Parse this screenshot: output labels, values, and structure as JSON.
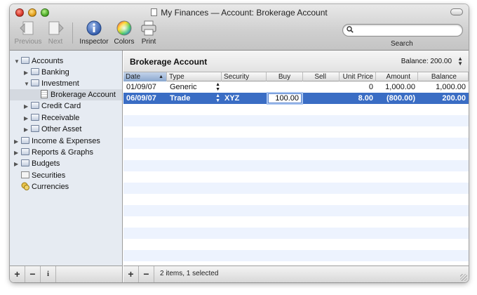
{
  "window": {
    "title": "My Finances — Account: Brokerage Account"
  },
  "toolbar": {
    "previous": "Previous",
    "next": "Next",
    "inspector": "Inspector",
    "colors": "Colors",
    "print": "Print",
    "search_label": "Search",
    "search_value": ""
  },
  "sidebar": {
    "accounts": "Accounts",
    "banking": "Banking",
    "investment": "Investment",
    "brokerage": "Brokerage Account",
    "credit_card": "Credit Card",
    "receivable": "Receivable",
    "other_asset": "Other Asset",
    "income_expenses": "Income & Expenses",
    "reports_graphs": "Reports & Graphs",
    "budgets": "Budgets",
    "securities": "Securities",
    "currencies": "Currencies"
  },
  "account": {
    "name": "Brokerage Account",
    "balance": "Balance: 200.00"
  },
  "columns": [
    "Date",
    "Type",
    "Security",
    "Buy",
    "Sell",
    "Unit Price",
    "Amount",
    "Balance"
  ],
  "rows": [
    {
      "date": "01/09/07",
      "type": "Generic",
      "security": "",
      "buy": "",
      "sell": "",
      "unit_price": "0",
      "amount": "1,000.00",
      "balance": "1,000.00"
    },
    {
      "date": "06/09/07",
      "type": "Trade",
      "security": "XYZ",
      "buy": "100.00",
      "sell": "",
      "unit_price": "8.00",
      "amount": "(800.00)",
      "balance": "200.00"
    }
  ],
  "footer": {
    "add": "+",
    "remove": "−",
    "info": "i",
    "status": "2 items, 1 selected"
  },
  "colors": {
    "selection": "#3a6dc4",
    "stripe": "#edf3fe",
    "sidebar_bg": "#e6ebf2"
  }
}
